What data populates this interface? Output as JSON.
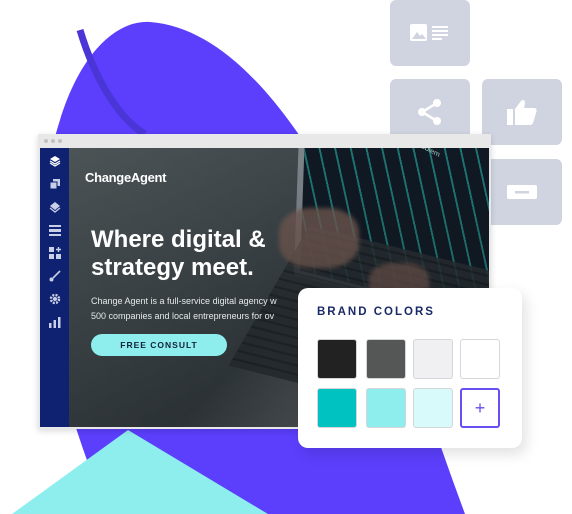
{
  "colors": {
    "blob_purple": "#5b3ffc",
    "blob_stripe": "#4a35d6",
    "teal_triangle": "#8eeeed",
    "tile_gray": "#cfd4e0",
    "sidebar_navy": "#0f2272",
    "accent_purple": "#6650ef"
  },
  "widget_tiles": [
    {
      "icon": "image-text-icon"
    },
    {
      "icon": "share-icon"
    },
    {
      "icon": "thumbs-up-icon"
    },
    {
      "icon": "button-icon"
    }
  ],
  "editor": {
    "sidebar_icons": [
      "layers-stack-icon",
      "duplicate-icon",
      "layers-icon",
      "sections-icon",
      "add-widget-icon",
      "brush-icon",
      "gear-icon",
      "analytics-icon"
    ],
    "site": {
      "logo": "ChangeAgent",
      "headline_line1": "Where digital &",
      "headline_line2": "strategy meet.",
      "desc_line1": "Change Agent is a full-service digital agency w",
      "desc_line2": "500 companies and local entrepreneurs for ov",
      "cta_label": "FREE CONSULT",
      "screen_text": "digital solutions for customer problem"
    }
  },
  "brand_colors": {
    "title": "BRAND COLORS",
    "swatches": [
      "#222222",
      "#555757",
      "#f0f0f2",
      "#ffffff",
      "#00c2c1",
      "#8eeeed",
      "#d8fafa"
    ],
    "add_label": "+"
  }
}
